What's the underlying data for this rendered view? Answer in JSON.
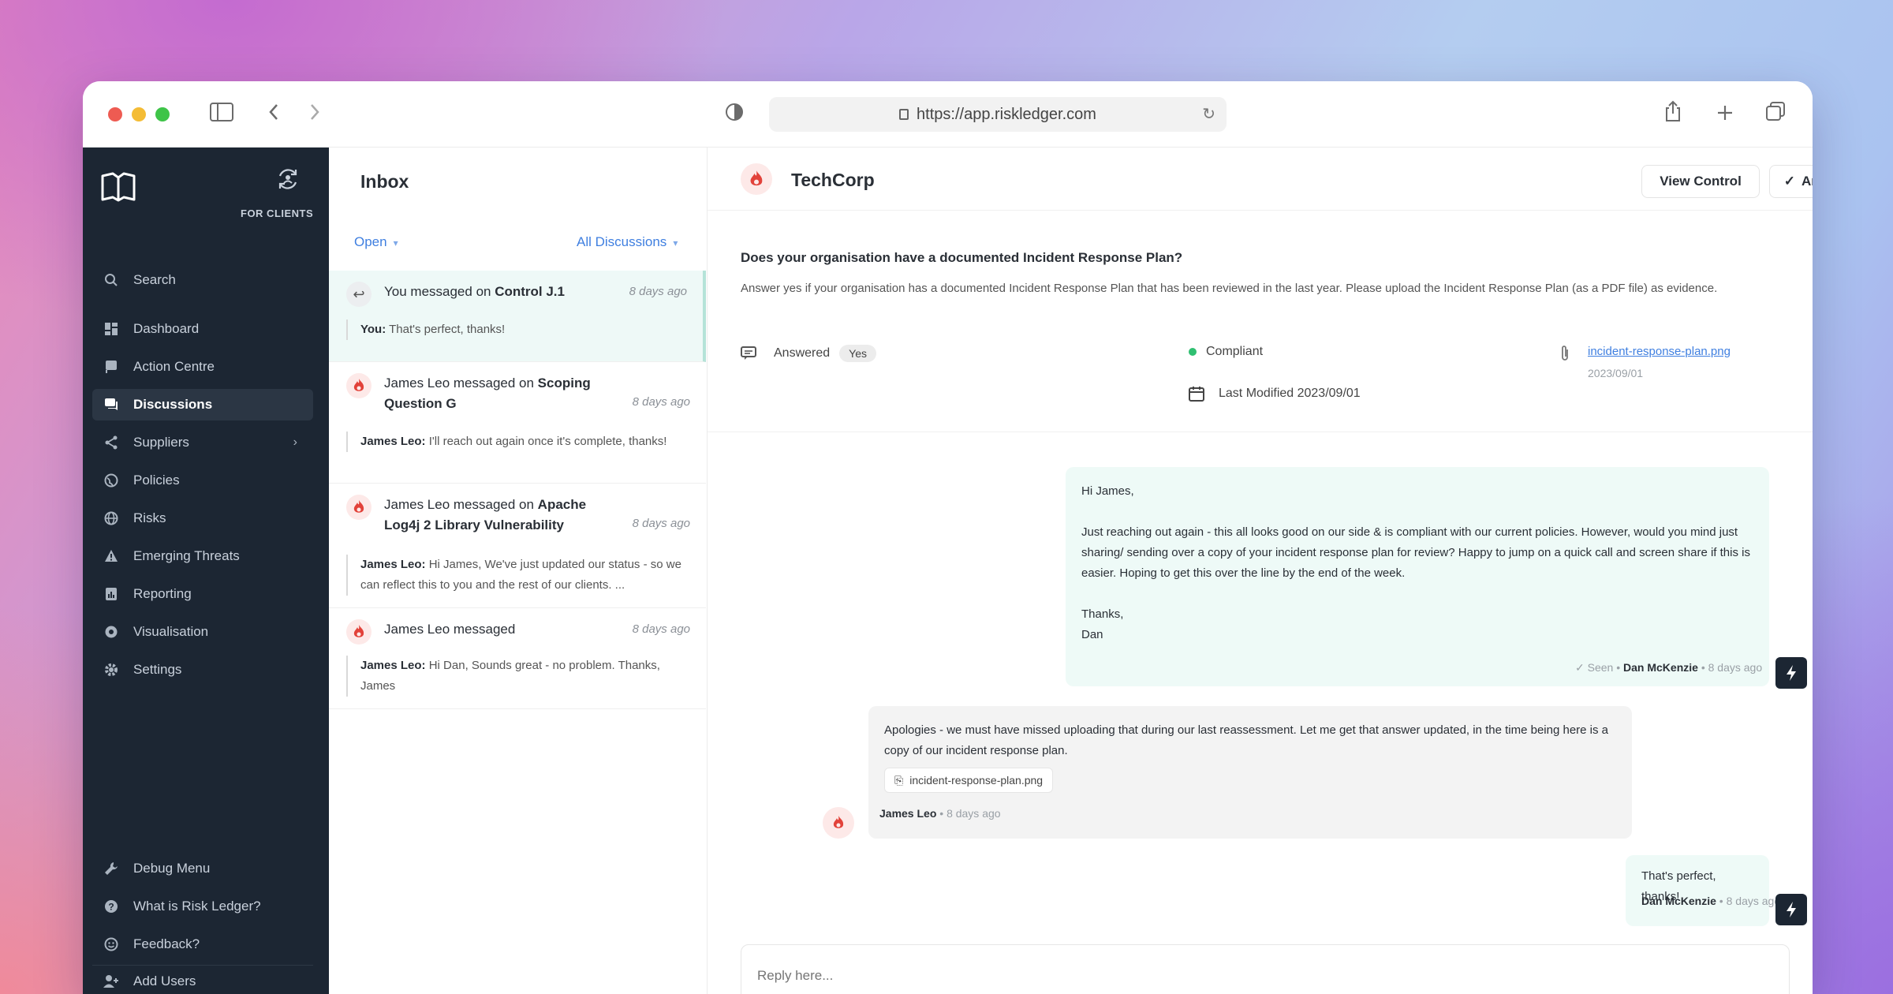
{
  "browser": {
    "url": "https://app.riskledger.com"
  },
  "sidebar": {
    "for_clients": "FOR CLIENTS",
    "items": [
      {
        "label": "Search"
      },
      {
        "label": "Dashboard"
      },
      {
        "label": "Action Centre"
      },
      {
        "label": "Discussions"
      },
      {
        "label": "Suppliers"
      },
      {
        "label": "Policies"
      },
      {
        "label": "Risks"
      },
      {
        "label": "Emerging Threats"
      },
      {
        "label": "Reporting"
      },
      {
        "label": "Visualisation"
      },
      {
        "label": "Settings"
      }
    ],
    "bottom_items": [
      {
        "label": "Debug Menu"
      },
      {
        "label": "What is Risk Ledger?"
      },
      {
        "label": "Feedback?"
      },
      {
        "label": "Add Users"
      }
    ]
  },
  "inbox": {
    "title": "Inbox",
    "filter_status": "Open",
    "filter_type": "All Discussions",
    "items": [
      {
        "prefix": "You messaged on ",
        "subject": "Control J.1",
        "time": "8 days ago",
        "preview_author": "You:",
        "preview_text": " That's perfect, thanks!"
      },
      {
        "prefix": "James Leo messaged on ",
        "subject": "Scoping Question G",
        "time": "8 days ago",
        "preview_author": "James Leo:",
        "preview_text": " I'll reach out again once it's complete, thanks!"
      },
      {
        "prefix": "James Leo messaged on ",
        "subject": "Apache Log4j 2 Library Vulnerability",
        "time": "8 days ago",
        "preview_author": "James Leo:",
        "preview_text": " Hi James, We've just updated our status - so we can reflect this to you and the rest of our clients. ..."
      },
      {
        "prefix": "James Leo messaged",
        "subject": "",
        "time": "8 days ago",
        "preview_author": "James Leo:",
        "preview_text": " Hi Dan, Sounds great - no problem. Thanks, James"
      }
    ]
  },
  "detail": {
    "company": "TechCorp",
    "view_control_label": "View Control",
    "archive_label": "Archive",
    "question": "Does your organisation have a documented Incident Response Plan?",
    "question_help": "Answer yes if your organisation has a documented Incident Response Plan that has been reviewed in the last year. Please upload the Incident Response Plan (as a PDF file) as evidence.",
    "answered_label": "Answered",
    "answer_value": "Yes",
    "compliance": "Compliant",
    "last_modified": "Last Modified 2023/09/01",
    "attachment_name": "incident-response-plan.png",
    "attachment_date": "2023/09/01",
    "colors": {
      "accent": "#3f7fe0",
      "compliant": "#2fbf71",
      "sidebar": "#1c2633"
    }
  },
  "messages": [
    {
      "lines": [
        "Hi James,",
        "",
        "Just reaching out again - this all looks good on our side & is compliant with our current policies. However, would you mind just sharing/ sending over a copy of your incident response plan for review? Happy to jump on a quick call and screen share if this is easier. Hoping to get this over the line by the end of the week.",
        "",
        "Thanks,",
        "Dan"
      ],
      "seen": "✓ Seen",
      "author": "Dan McKenzie",
      "time": "8 days ago"
    },
    {
      "text": "Apologies - we must have missed uploading that during our last reassessment. Let me get that answer updated, in the time being here is a copy of our incident response plan.",
      "attachment": "incident-response-plan.png",
      "author": "James Leo",
      "time": "8 days ago"
    },
    {
      "text": "That's perfect, thanks!",
      "author": "Dan McKenzie",
      "time": "8 days ago"
    }
  ],
  "reply": {
    "placeholder": "Reply here..."
  }
}
